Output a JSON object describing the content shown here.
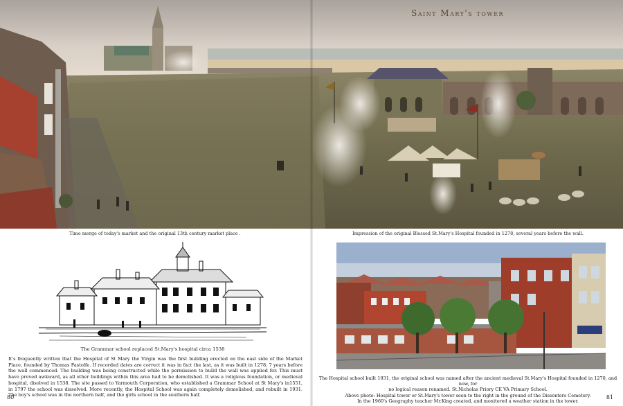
{
  "header": {
    "section_title": "Saint Mary's tower"
  },
  "captions": {
    "hero_left": "Time merge of today's market and the original 13th century market place .",
    "hero_right": "Impression of the original Blessed St.Mary's Hospital founded in 1278, several years before the wall.",
    "sketch": "The Grammar school replaced St.Mary's hospital circa 1538"
  },
  "left_page": {
    "body": "It's frequently written that the Hospital of St Mary the Virgin was the first building erected on the east side of the Market Place, founded by Thomas Fastolfe. If recorded dates are correct it was in fact the last, as it was built in 1278, 7 years before the wall commenced. The building was being constructed while the permission to build the wall was applied for. This must have proved awkward, as all other buildings within this area had to be demolished. It was a religious foundation, or medieval hospital, disolved in 1538. The site passed to Yarmouth Corporation, who established a Grammar School at St Mary's in1551, in 1797 the school was dissolved. More recently, the Hospital School was again completely demolished, and rebuilt in 1931. The boy's school was in the northern half, and the girls school in the southern half.",
    "page_number": "80"
  },
  "right_page": {
    "lines": [
      "The Hospital school built 1931, the original school was named after the ancient medieval St.Mary's Hospital founded in 1270, and now, for",
      "no logical reason renamed. St.Nicholas Priory CE VA Primary School.",
      "Above photo: Hospital tower or St.Mary's tower seen to the right in the ground of the Dissenters Cemetery.",
      "In the 1960's Geography teacher Mr.King created, and monitored a weather station in the tower."
    ],
    "page_number": "81"
  },
  "colors": {
    "title": "#5a4632",
    "sky": "#cfc6bd",
    "field": "#7d7658",
    "brick": "#9a3b2c"
  }
}
